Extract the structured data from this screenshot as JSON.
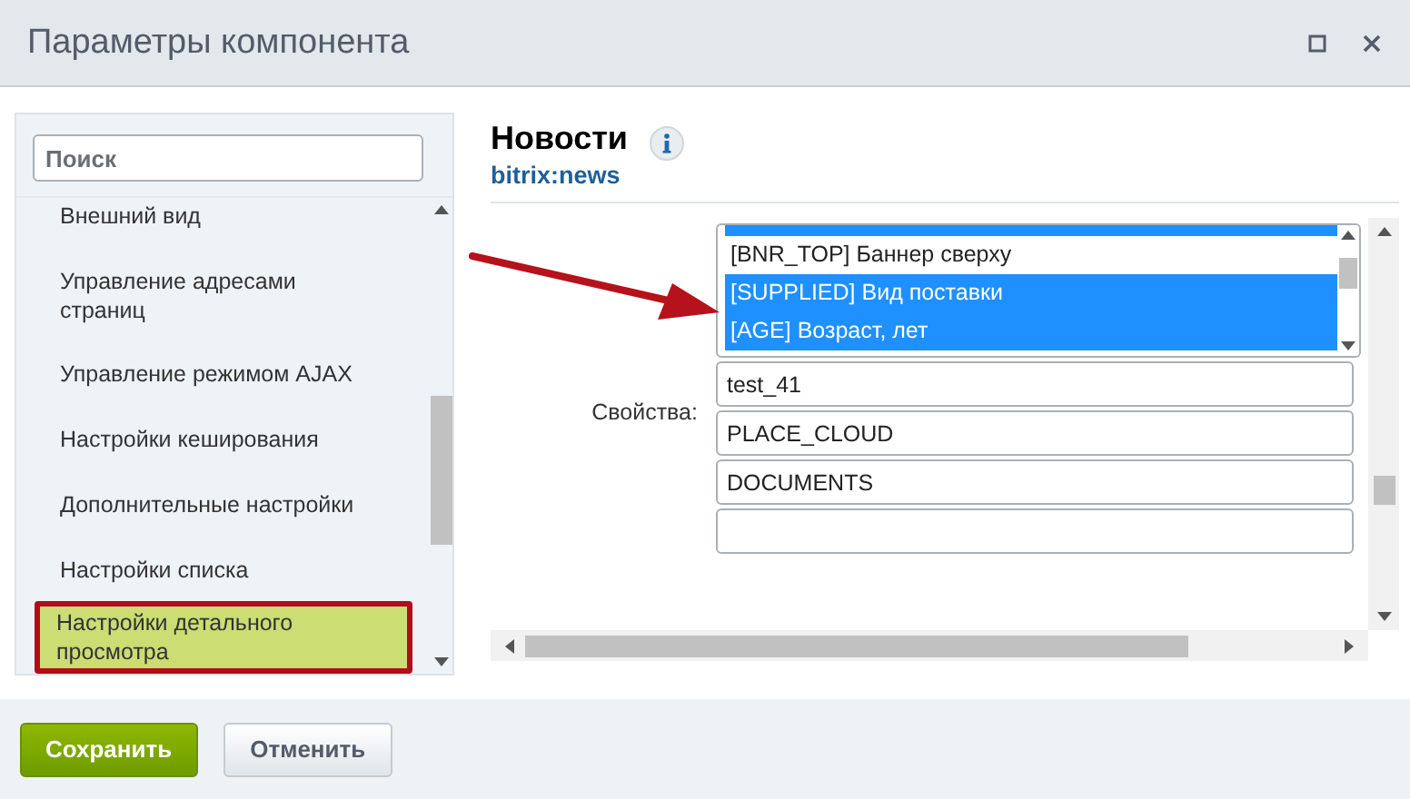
{
  "window": {
    "title": "Параметры компонента"
  },
  "sidebar": {
    "search": {
      "placeholder": "Поиск"
    },
    "items": [
      {
        "label": "Внешний вид",
        "selected": false
      },
      {
        "label": "Управление адресами страниц",
        "selected": false
      },
      {
        "label": "Управление режимом AJAX",
        "selected": false
      },
      {
        "label": "Настройки кеширования",
        "selected": false
      },
      {
        "label": "Дополнительные настройки",
        "selected": false
      },
      {
        "label": "Настройки списка",
        "selected": false
      },
      {
        "label": "Настройки детального просмотра",
        "selected": true
      }
    ]
  },
  "component": {
    "name": "Новости",
    "code": "bitrix:news"
  },
  "properties": {
    "label": "Свойства:",
    "options": [
      {
        "label": "[BNR_TOP] Баннер сверху",
        "selected": false
      },
      {
        "label": "[SUPPLIED] Вид поставки",
        "selected": true
      },
      {
        "label": "[AGE] Возраст, лет",
        "selected": true
      }
    ],
    "inputs": [
      "test_41",
      "PLACE_CLOUD",
      "DOCUMENTS"
    ]
  },
  "buttons": [
    {
      "label": "Сохранить",
      "kind": "primary"
    },
    {
      "label": "Отменить",
      "kind": "secondary"
    }
  ]
}
